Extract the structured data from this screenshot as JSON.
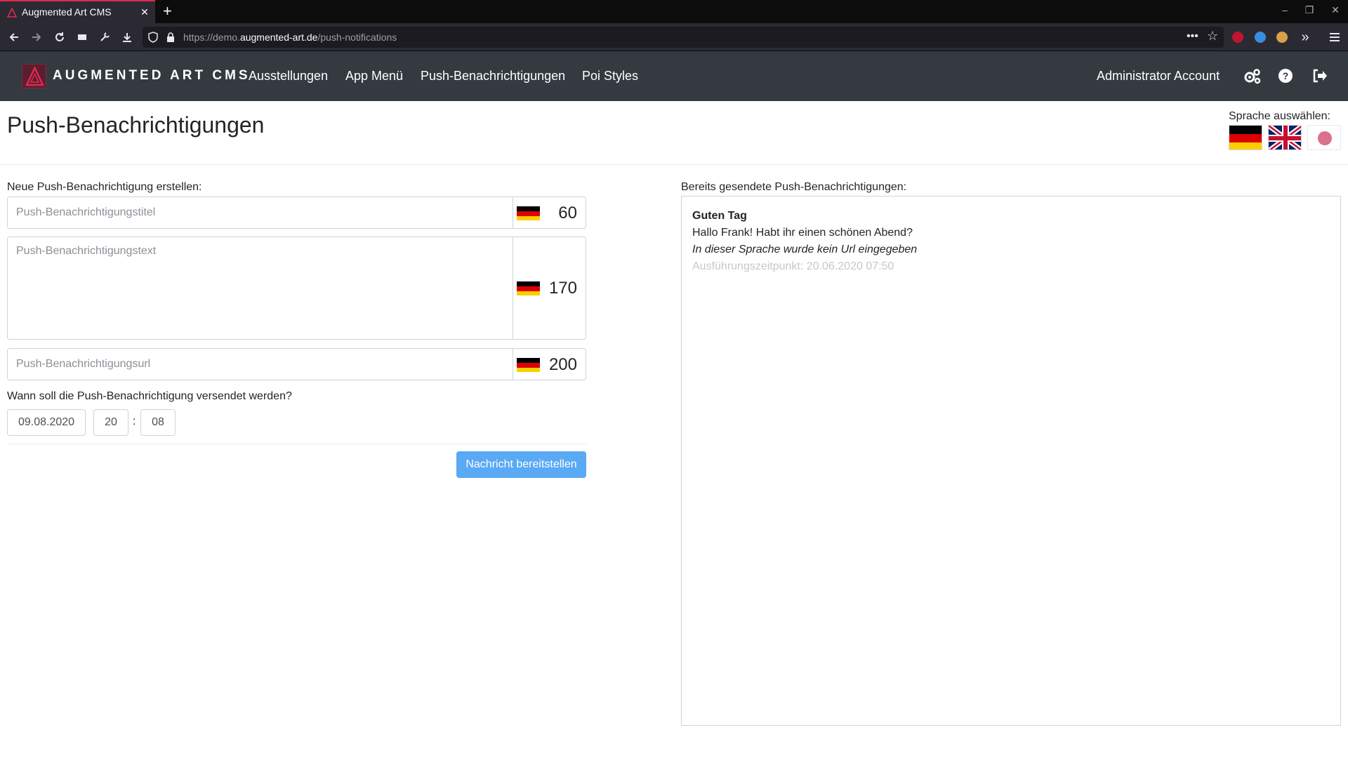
{
  "browser": {
    "tab_title": "Augmented Art CMS",
    "tab_close": "✕",
    "new_tab": "+",
    "url_prefix": "https://demo.",
    "url_host": "augmented-art.de",
    "url_path": "/push-notifications",
    "window_controls": {
      "minimize": "–",
      "restore": "❐",
      "close": "✕"
    }
  },
  "app": {
    "brand": "AUGMENTED ART CMS",
    "menu": [
      {
        "label": "Ausstellungen"
      },
      {
        "label": "App Menü"
      },
      {
        "label": "Push-Benachrichtigungen"
      },
      {
        "label": "Poi Styles"
      }
    ],
    "account": "Administrator Account",
    "icons": [
      "gears-icon",
      "help-icon",
      "logout-icon"
    ]
  },
  "page": {
    "title": "Push-Benachrichtigungen",
    "language_label": "Sprache auswählen:",
    "languages": [
      "de",
      "en",
      "ja"
    ]
  },
  "form": {
    "heading": "Neue Push-Benachrichtigung erstellen:",
    "title_field": {
      "placeholder": "Push-Benachrichtigungstitel",
      "count": "60"
    },
    "text_field": {
      "placeholder": "Push-Benachrichtigungstext",
      "count": "170"
    },
    "url_field": {
      "placeholder": "Push-Benachrichtigungsurl",
      "count": "200"
    },
    "schedule_label": "Wann soll die Push-Benachrichtigung versendet werden?",
    "date": "09.08.2020",
    "hour": "20",
    "separator": ":",
    "minute": "08",
    "submit": "Nachricht bereitstellen"
  },
  "sent": {
    "heading": "Bereits gesendete Push-Benachrichtigungen:",
    "items": [
      {
        "title": "Guten Tag",
        "body": "Hallo Frank! Habt ihr einen schönen Abend?",
        "url_note": "In dieser Sprache wurde kein Url eingegeben",
        "time": "Ausführungszeitpunkt: 20.06.2020 07:50"
      }
    ]
  },
  "colors": {
    "accent": "#e22850",
    "app_header": "#343a40",
    "submit": "#59a9f5"
  }
}
